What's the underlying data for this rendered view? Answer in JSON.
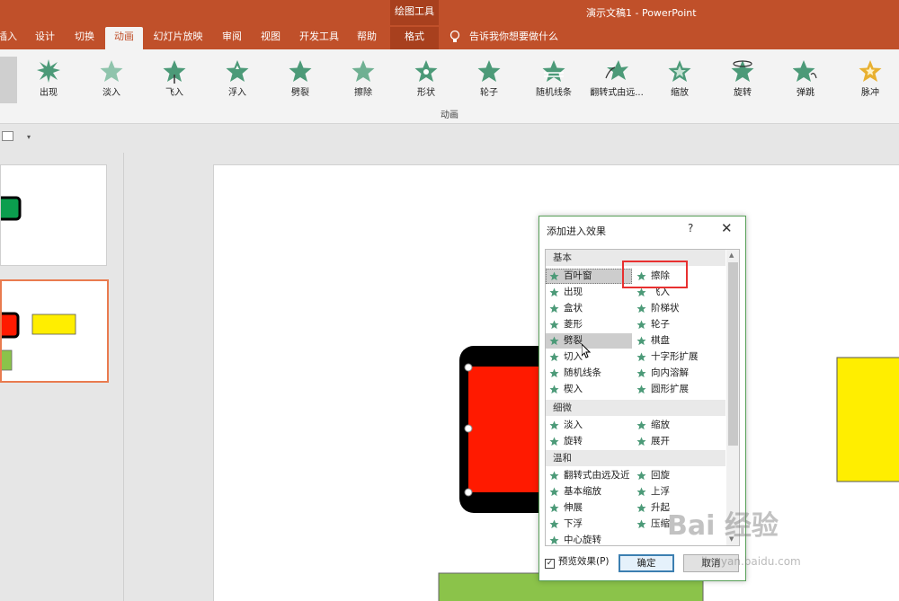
{
  "window": {
    "drawing_tools": "绘图工具",
    "doc_title": "演示文稿1 - PowerPoint"
  },
  "tabs": [
    {
      "label": "插入"
    },
    {
      "label": "设计"
    },
    {
      "label": "切换"
    },
    {
      "label": "动画"
    },
    {
      "label": "幻灯片放映"
    },
    {
      "label": "审阅"
    },
    {
      "label": "视图"
    },
    {
      "label": "开发工具"
    },
    {
      "label": "帮助"
    },
    {
      "label": "格式"
    }
  ],
  "tell_me": "告诉我你想要做什么",
  "ribbon": {
    "items": [
      {
        "label": "出现"
      },
      {
        "label": "淡入"
      },
      {
        "label": "飞入"
      },
      {
        "label": "浮入"
      },
      {
        "label": "劈裂"
      },
      {
        "label": "擦除"
      },
      {
        "label": "形状"
      },
      {
        "label": "轮子"
      },
      {
        "label": "随机线条"
      },
      {
        "label": "翻转式由远..."
      },
      {
        "label": "缩放"
      },
      {
        "label": "旋转"
      },
      {
        "label": "弹跳"
      },
      {
        "label": "脉冲"
      }
    ],
    "group_label": "动画"
  },
  "colors": {
    "accent": "#c0502a",
    "star_green": "#4c9a78",
    "star_gold": "#e8b030",
    "shape_red": "#ff1a00",
    "shape_yellow": "#ffee00",
    "shape_green": "#8bc34a",
    "shape_dark_green": "#0b9e4e"
  },
  "dialog": {
    "title": "添加进入效果",
    "help": "?",
    "close": "✕",
    "categories": [
      "基本",
      "细微",
      "温和"
    ],
    "basic_left": [
      "百叶窗",
      "出现",
      "盒状",
      "菱形",
      "劈裂",
      "切入",
      "随机线条",
      "楔入"
    ],
    "basic_right": [
      "擦除",
      "飞入",
      "阶梯状",
      "轮子",
      "棋盘",
      "十字形扩展",
      "向内溶解",
      "圆形扩展"
    ],
    "subtle_left": [
      "淡入",
      "旋转"
    ],
    "subtle_right": [
      "缩放",
      "展开"
    ],
    "moderate_left": [
      "翻转式由远及近",
      "基本缩放",
      "伸展",
      "下浮",
      "中心旋转"
    ],
    "moderate_right": [
      "回旋",
      "上浮",
      "升起",
      "压缩"
    ],
    "preview_label": "预览效果(P)",
    "preview_checked": "✓",
    "ok": "确定",
    "cancel": "取消"
  },
  "watermark": {
    "text": "Bai 经验",
    "sub": "jingyan.baidu.com"
  }
}
